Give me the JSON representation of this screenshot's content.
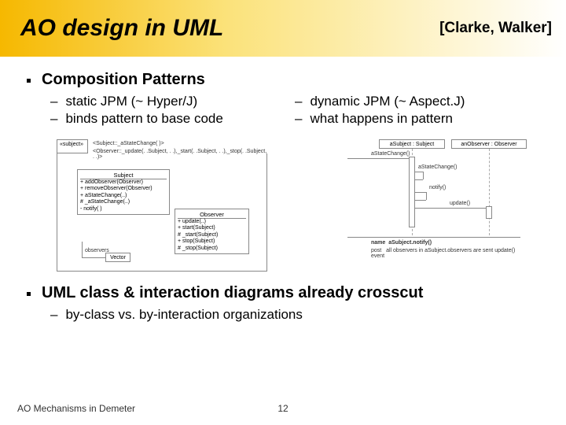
{
  "header": {
    "title": "AO design in UML",
    "citation": "[Clarke, Walker]"
  },
  "bullets": {
    "b1": "Composition Patterns",
    "b1_left": [
      "static JPM (~ Hyper/J)",
      "binds pattern to base code"
    ],
    "b1_right": [
      "dynamic JPM (~ Aspect.J)",
      "what happens in pattern"
    ],
    "b2": "UML class & interaction diagrams already crosscut",
    "b2_sub": [
      "by-class vs. by-interaction organizations"
    ]
  },
  "diagram_left": {
    "stereotype": "«subject»",
    "top_interaction": "<Subject::_aStateChange(  )>",
    "top_interaction2": "<Observer::_update(. .Subject, . .),_start(. .Subject, . .),_stop(. .Subject, . .)>",
    "subject_box": {
      "name": "Subject",
      "ops": [
        "+ addObserver(Observer)",
        "+ removeObserver(Observer)",
        "+ aStateChange(..)",
        "# _aStateChange(..)",
        "- notify( )"
      ]
    },
    "observer_box": {
      "name": "Observer",
      "ops": [
        "+ update(..)",
        "+ start(Subject)",
        "# _start(Subject)",
        "+ stop(Subject)",
        "# _stop(Subject)"
      ]
    },
    "assoc_role": "observers",
    "assoc_card": "Vector"
  },
  "diagram_right": {
    "obj1": "aSubject : Subject",
    "obj2": "anObserver : Observer",
    "msg1": "aStateChange()",
    "msg2": "aStateChange()",
    "msg3": "notify()",
    "msg4": "update()",
    "constraint": {
      "name": "aSubject.notify()",
      "post": "all observers in aSubject.observers are sent update() event"
    }
  },
  "footer": {
    "left": "AO Mechanisms in Demeter",
    "page": "12"
  }
}
